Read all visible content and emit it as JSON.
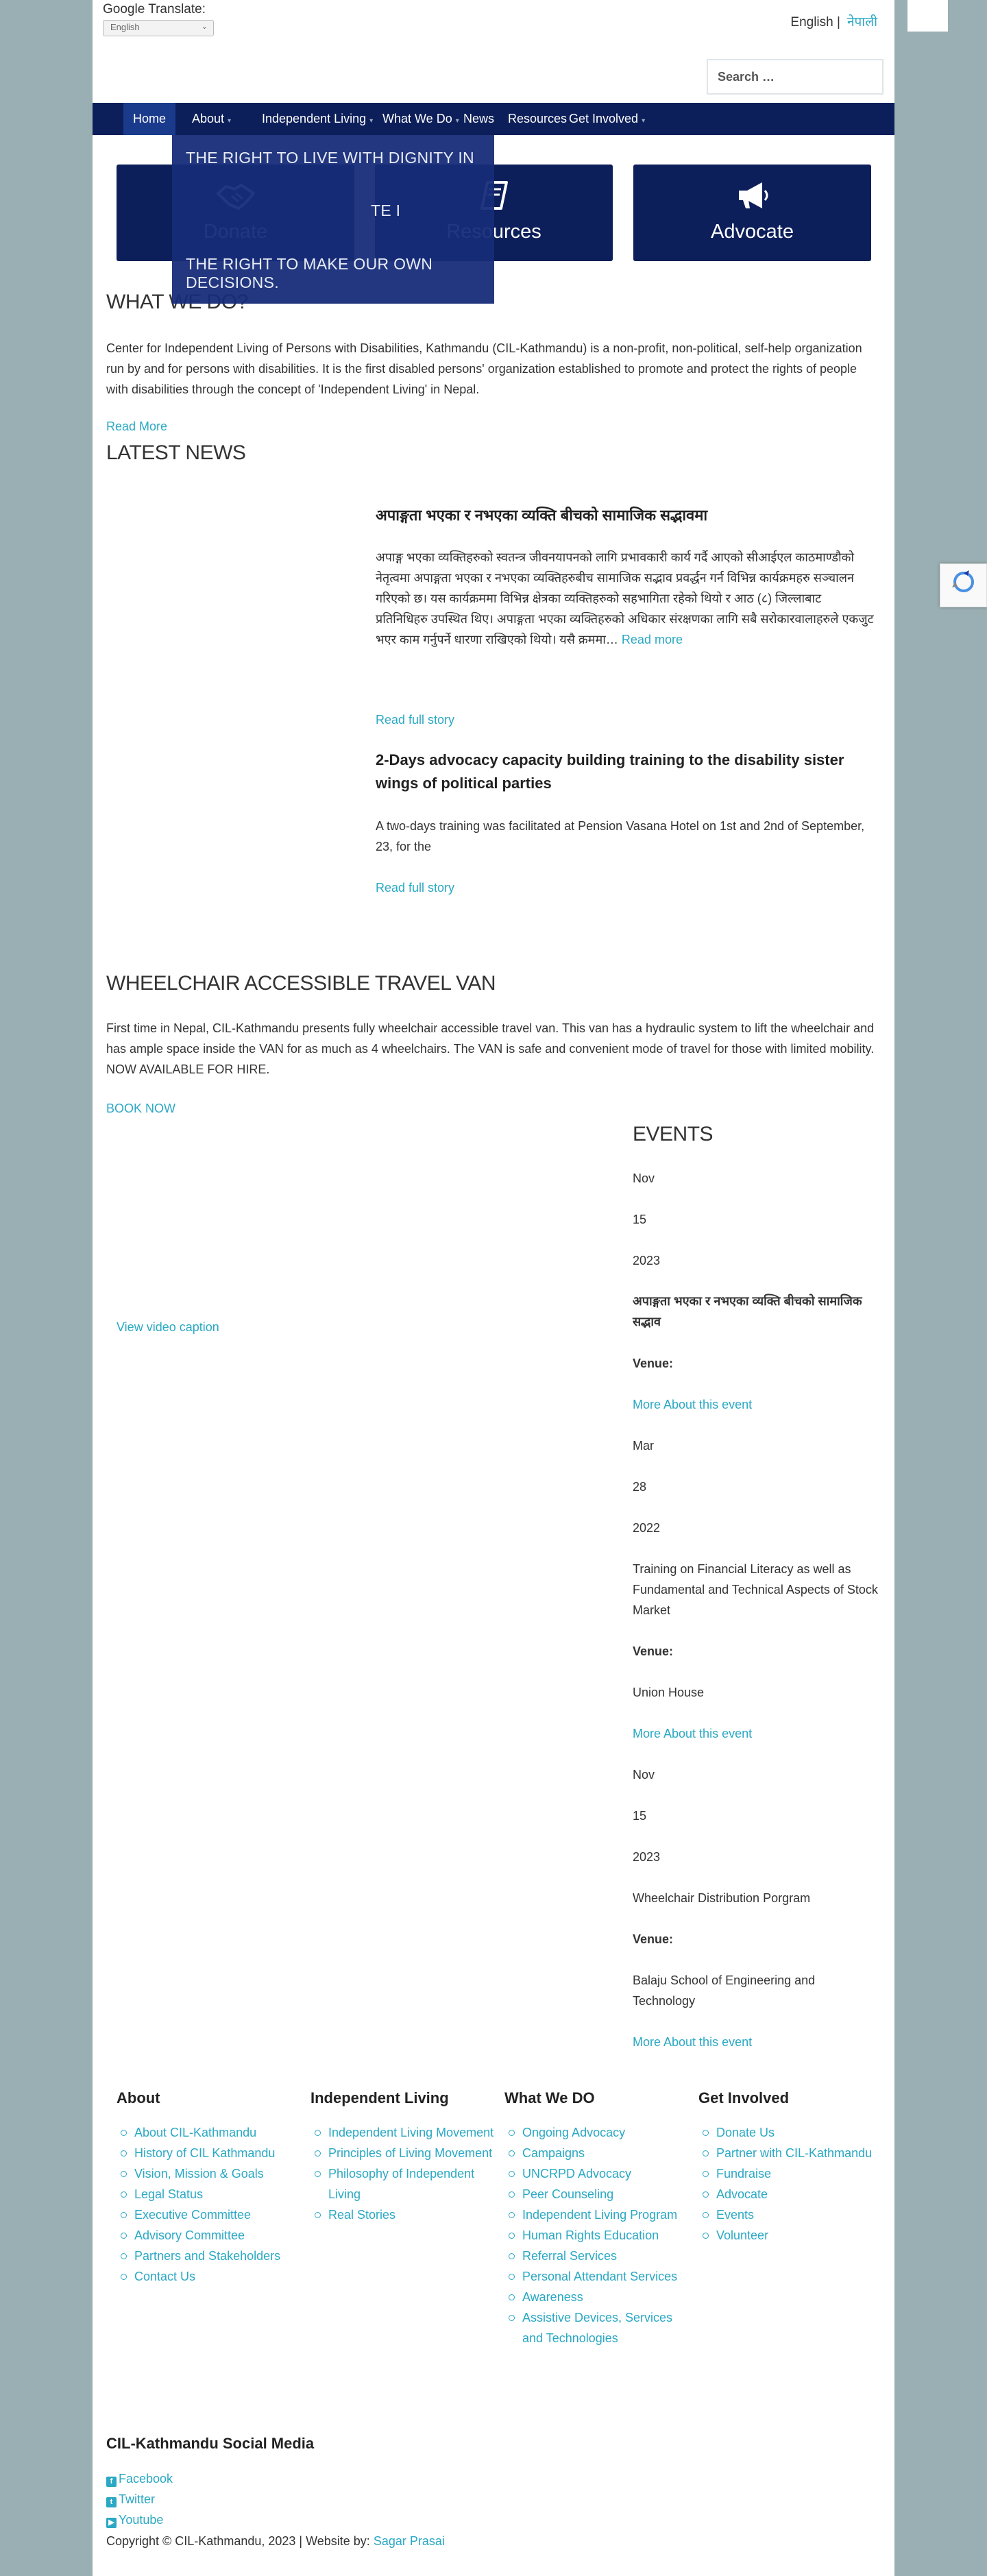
{
  "header": {
    "translate_label": "Google Translate:",
    "translate_select": "English",
    "lang_current": "English |",
    "lang_other": "नेपाली",
    "search_placeholder": "Search …"
  },
  "nav": {
    "items": [
      {
        "label": "Home",
        "has_caret": false
      },
      {
        "label": "About",
        "has_caret": true
      },
      {
        "label": "Independent Living",
        "has_caret": true
      },
      {
        "label": "What We Do",
        "has_caret": true
      },
      {
        "label": "News",
        "has_caret": false
      },
      {
        "label": "Resources",
        "has_caret": false
      },
      {
        "label": "Get Involved",
        "has_caret": true
      }
    ],
    "dropdown_lines": [
      "THE RIGHT TO LIVE WITH DIGNITY IN",
      "TE I",
      "THE RIGHT TO MAKE OUR OWN DECISIONS."
    ]
  },
  "cta": {
    "donate": "Donate",
    "resources": "Resources",
    "advocate": "Advocate"
  },
  "what_we_do": {
    "heading": "WHAT WE DO?",
    "text": "Center for Independent Living of Persons with Disabilities, Kathmandu (CIL-Kathmandu) is a non-profit, non-political, self-help organization run by and for persons with disabilities. It is the first disabled persons' organization established to promote and protect the rights of people with disabilities through the concept of 'Independent Living' in Nepal.",
    "read_more": "Read More"
  },
  "news": {
    "heading": "LATEST NEWS",
    "items": [
      {
        "title": "अपाङ्गता भएका र नभएका व्यक्ति बीचको सामाजिक सद्भावमा",
        "body": "अपाङ्ग भएका व्यक्तिहरुको स्वतन्त्र जीवनयापनको लागि प्रभावकारी कार्य गर्दै आएको सीआईएल काठमाण्डौको नेतृत्वमा अपाङ्गता भएका र नभएका व्यक्तिहरुबीच सामाजिक सद्भाव प्रवर्द्धन गर्न विभिन्न कार्यक्रमहरु सञ्चालन गरिएको छ। यस कार्यक्रममा विभिन्न क्षेत्रका व्यक्तिहरुको सहभागिता रहेको थियो र आठ (८) जिल्लाबाट प्रतिनिधिहरु उपस्थित थिए। अपाङ्गता भएका व्यक्तिहरुको अधिकार संरक्षणका लागि सबै सरोकारवालाहरुले एकजुट भएर काम गर्नुपर्ने धारणा राखिएको थियो। यसै क्रममा…",
        "read_more": "Read more",
        "full": "Read full story"
      },
      {
        "title": "2-Days advocacy capacity building training to the disability sister wings of political parties",
        "body": "A two-days training was facilitated at Pension Vasana Hotel on 1st and 2nd of September, 23, for the",
        "full": "Read full story"
      }
    ]
  },
  "van": {
    "heading": "WHEELCHAIR ACCESSIBLE TRAVEL VAN",
    "text": "First time in Nepal, CIL-Kathmandu presents fully wheelchair accessible travel van. This van has a hydraulic system to lift the wheelchair and has ample space inside the VAN for as much as 4 wheelchairs. The VAN is safe and convenient mode of travel for those with limited mobility. NOW AVAILABLE FOR HIRE.",
    "book": "BOOK NOW",
    "video_caption": "View video caption"
  },
  "events": {
    "heading": "EVENTS",
    "venue_label": "Venue:",
    "more_label": "More About this event",
    "items": [
      {
        "month": "Nov",
        "day": "15",
        "year": "2023",
        "title": "अपाङ्गता भएका र नभएका व्यक्ति बीचको सामाजिक सद्भाव",
        "venue": ""
      },
      {
        "month": "Mar",
        "day": "28",
        "year": "2022",
        "title": "Training on Financial Literacy as well as Fundamental and Technical Aspects of Stock Market",
        "venue": "Union House"
      },
      {
        "month": "Nov",
        "day": "15",
        "year": "2023",
        "title": "Wheelchair Distribution Porgram",
        "venue": "Balaju School of Engineering and Technology"
      }
    ]
  },
  "footer": {
    "columns": [
      {
        "title": "About",
        "links": [
          "About CIL-Kathmandu",
          "History of CIL Kathmandu",
          "Vision, Mission & Goals",
          "Legal Status",
          "Executive Committee",
          "Advisory Committee",
          "Partners and Stakeholders",
          "Contact Us"
        ]
      },
      {
        "title": "Independent Living",
        "links": [
          "Independent Living Movement",
          "Principles of Living Movement",
          "Philosophy of Independent Living",
          "Real Stories"
        ]
      },
      {
        "title": "What We DO",
        "links": [
          "Ongoing Advocacy",
          "Campaigns",
          "UNCRPD Advocacy",
          "Peer Counseling",
          "Independent Living Program",
          "Human Rights Education",
          "Referral Services",
          "Personal Attendant Services",
          "Awareness",
          "Assistive Devices, Services and Technologies"
        ]
      },
      {
        "title": "Get Involved",
        "links": [
          "Donate Us",
          "Partner with CIL-Kathmandu",
          "Fundraise",
          "Advocate",
          "Events",
          "Volunteer"
        ]
      }
    ],
    "social_title": "CIL-Kathmandu Social Media",
    "social": [
      {
        "icon": "facebook-icon",
        "glyph": "f",
        "label": "Facebook"
      },
      {
        "icon": "twitter-icon",
        "glyph": "t",
        "label": "Twitter"
      },
      {
        "icon": "youtube-icon",
        "glyph": "▶",
        "label": "Youtube"
      }
    ],
    "copyright": "Copyright © CIL-Kathmandu,  2023  | Website by:",
    "author": "Sagar Prasai"
  }
}
